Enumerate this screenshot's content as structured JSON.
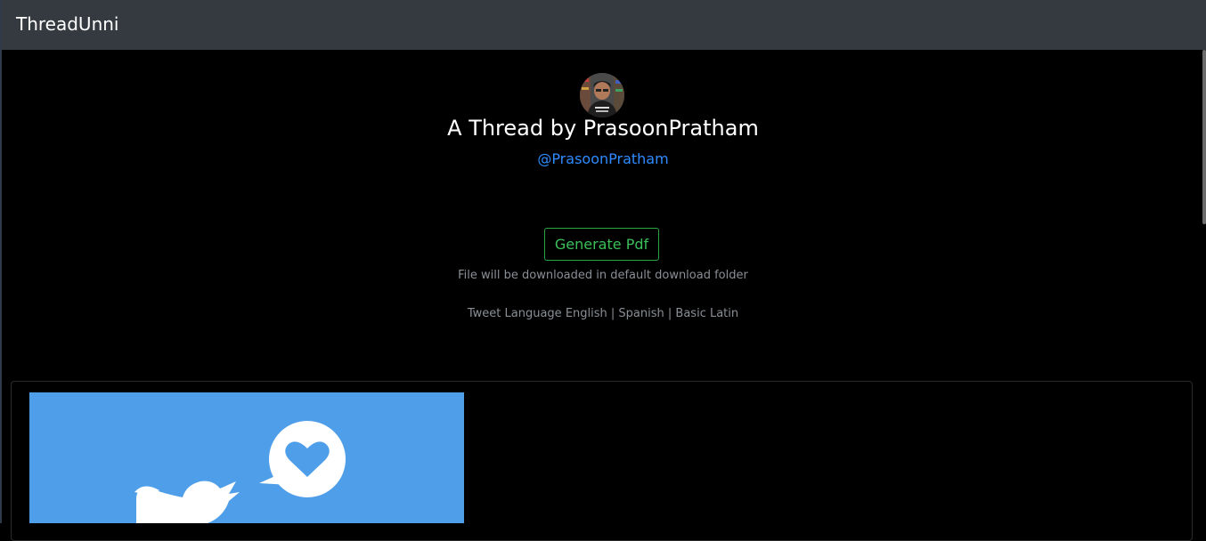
{
  "navbar": {
    "brand": "ThreadUnni"
  },
  "header": {
    "title": "A Thread by PrasoonPratham",
    "handle": "@PrasoonPratham"
  },
  "actions": {
    "generate_label": "Generate Pdf",
    "download_note": "File will be downloaded in default download folder"
  },
  "language": {
    "prefix": "Tweet Language",
    "options": [
      "English",
      "Spanish",
      "Basic Latin"
    ],
    "separator": " | "
  },
  "colors": {
    "navbar_bg": "#343a40",
    "page_bg": "#000000",
    "handle_link": "#2f8bff",
    "button_success": "#28a745",
    "card_image_bg": "#4f9ee9"
  },
  "icons": {
    "card_image": "twitter-bird-heart-icon"
  }
}
